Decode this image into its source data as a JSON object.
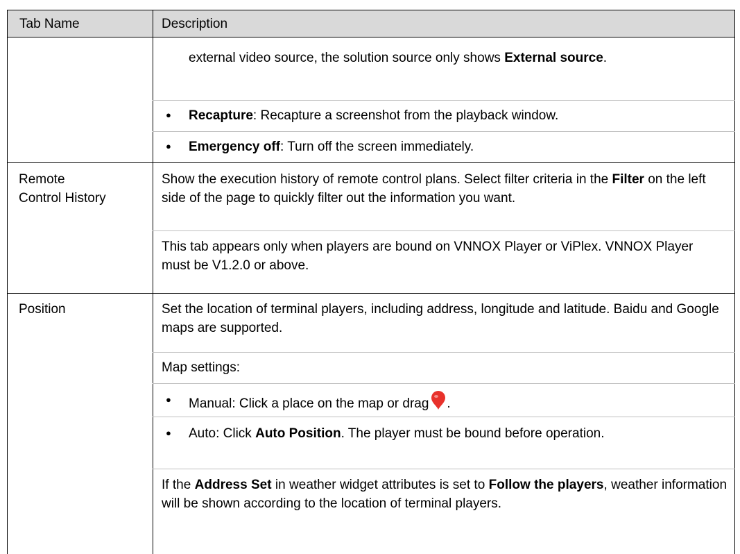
{
  "header": {
    "col1": "Tab Name",
    "col2": "Description"
  },
  "row1": {
    "cont_pre": "external video source, the solution source only shows ",
    "cont_bold": "External source",
    "cont_post": ".",
    "b1_bold": "Recapture",
    "b1_text": ": Recapture a screenshot from the playback window.",
    "b2_bold": "Emergency off",
    "b2_text": ": Turn off the screen immediately."
  },
  "row2": {
    "name_line1": "Remote",
    "name_line2": "Control History",
    "p1_a": "Show the execution history of remote control plans. Select filter criteria in the ",
    "p1_bold": "Filter",
    "p1_b": " on the left side of the page to quickly filter out the information you want.",
    "p2": "This tab appears only when players are bound on VNNOX Player or ViPlex. VNNOX Player must be V1.2.0 or above."
  },
  "row3": {
    "name": "Position",
    "p1": "Set the location of terminal players, including address, longitude and latitude. Baidu and Google maps are supported.",
    "p2": "Map settings:",
    "b1_text": "Manual: Click a place on the map or drag",
    "b1_end": ".",
    "b2_a": "Auto: Click ",
    "b2_bold": "Auto Position",
    "b2_b": ". The player must be bound before operation.",
    "p3_a": "If the ",
    "p3_bold1": "Address Set",
    "p3_b": " in weather widget attributes is set to ",
    "p3_bold2": "Follow the players",
    "p3_c": ", weather information will be shown according to the location of terminal players."
  },
  "icons": {
    "bullet": "●",
    "pin_color": "#e8312b"
  }
}
